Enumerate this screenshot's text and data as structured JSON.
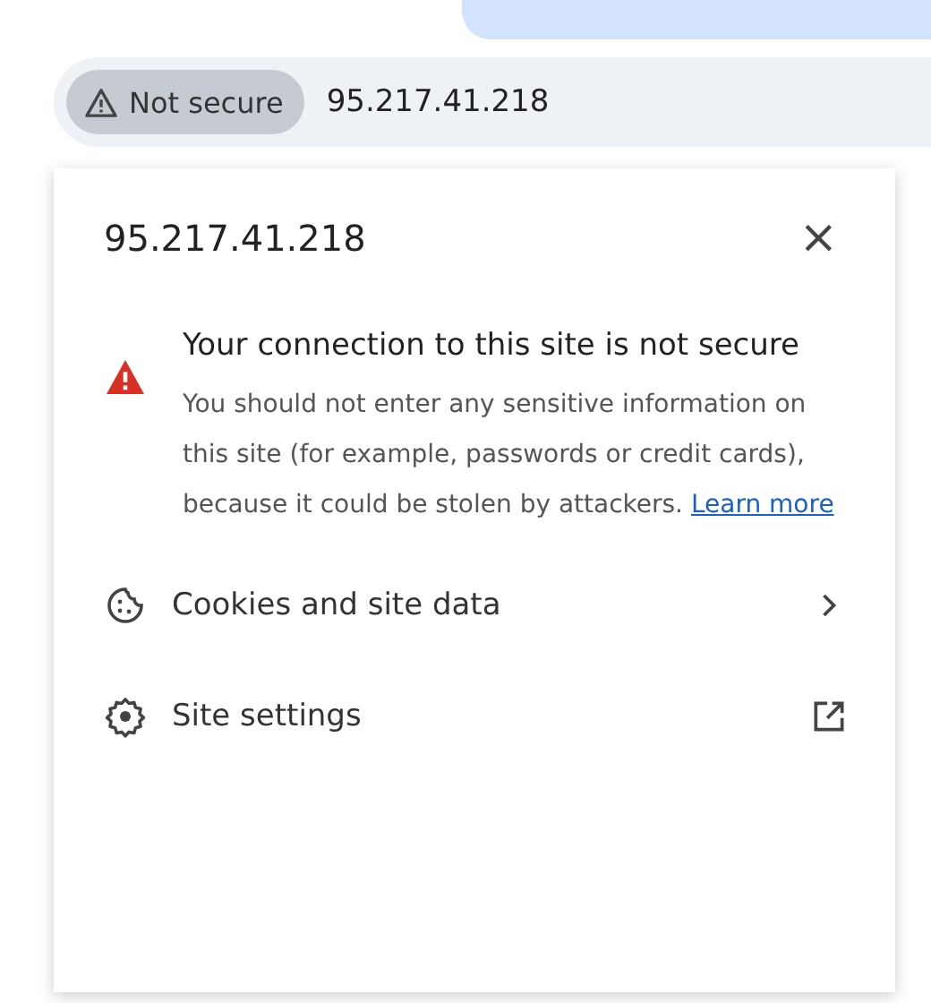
{
  "address_bar": {
    "security_chip": "Not secure",
    "url": "95.217.41.218"
  },
  "popup": {
    "title": "95.217.41.218",
    "close": "×",
    "warning": {
      "heading": "Your connection to this site is not secure",
      "body": "You should not enter any sensitive information on this site (for example, passwords or credit cards), because it could be stolen by attackers.",
      "link": "Learn more"
    },
    "items": [
      {
        "kind": "submenu",
        "label": "Cookies and site data"
      },
      {
        "kind": "external",
        "label": "Site settings"
      }
    ]
  }
}
